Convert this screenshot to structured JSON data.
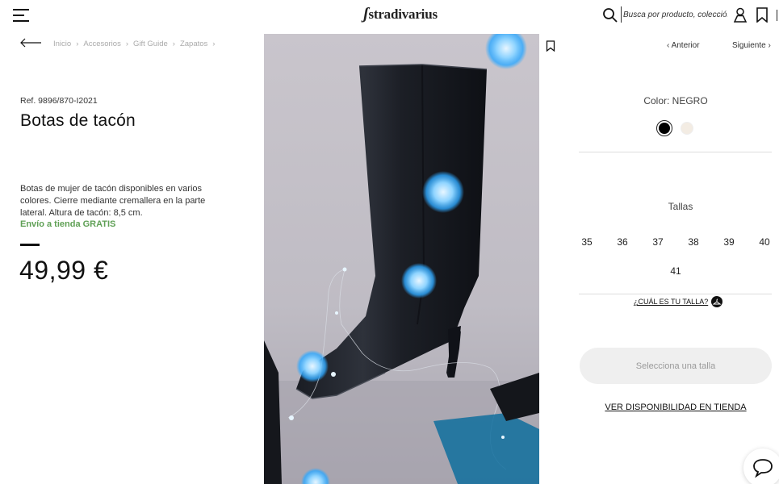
{
  "header": {
    "logo": "stradivarius",
    "search_placeholder": "Busca por producto, colección..."
  },
  "breadcrumb": [
    "Inicio",
    "Accesorios",
    "Gift Guide",
    "Zapatos"
  ],
  "product": {
    "ref": "Ref. 9896/870-I2021",
    "title": "Botas de tacón",
    "description": "Botas de mujer de tacón disponibles en varios colores. Cierre mediante cremallera en la parte lateral. Altura de tacón: 8,5 cm.",
    "shipping": "Envío a tienda GRATIS",
    "price": "49,99 €"
  },
  "navigation": {
    "prev": "Anterior",
    "next": "Siguiente"
  },
  "colors": {
    "label": "Color: NEGRO",
    "options": [
      "black",
      "cream"
    ],
    "selected": "black",
    "swatch_hex": [
      "#000000",
      "#f3ece3"
    ]
  },
  "sizes": {
    "label": "Tallas",
    "options": [
      "35",
      "36",
      "37",
      "38",
      "39",
      "40",
      "41"
    ],
    "guide_label": "¿CUÁL ES TU TALLA?"
  },
  "actions": {
    "select_size": "Selecciona una talla",
    "store_availability": "VER DISPONIBILIDAD EN TIENDA"
  },
  "icons": [
    "menu-icon",
    "search-icon",
    "user-icon",
    "bookmark-icon",
    "back-arrow-icon",
    "chat-icon",
    "hanger-icon"
  ],
  "theme": {
    "accent_green": "#5fa055",
    "button_bg": "#efefef",
    "bokeh_blue": "#2ea8ff"
  }
}
